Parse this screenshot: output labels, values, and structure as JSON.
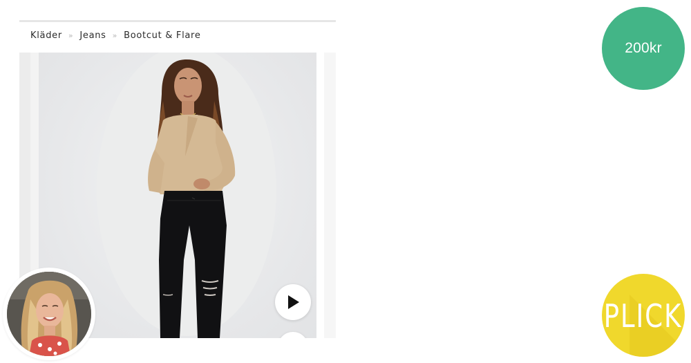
{
  "breadcrumb": [
    {
      "label": "Kläder"
    },
    {
      "label": "Jeans"
    },
    {
      "label": "Bootcut & Flare"
    }
  ],
  "breadcrumb_separator": "»",
  "price": "200kr",
  "logo": {
    "text": "PLICK"
  },
  "colors": {
    "price_badge": "#43b587",
    "logo_badge": "#f0d82c",
    "breadcrumb_text": "#2b2b2b",
    "separator": "#b5b5b5"
  },
  "icons": [
    "play-icon",
    "next-slide-button"
  ]
}
